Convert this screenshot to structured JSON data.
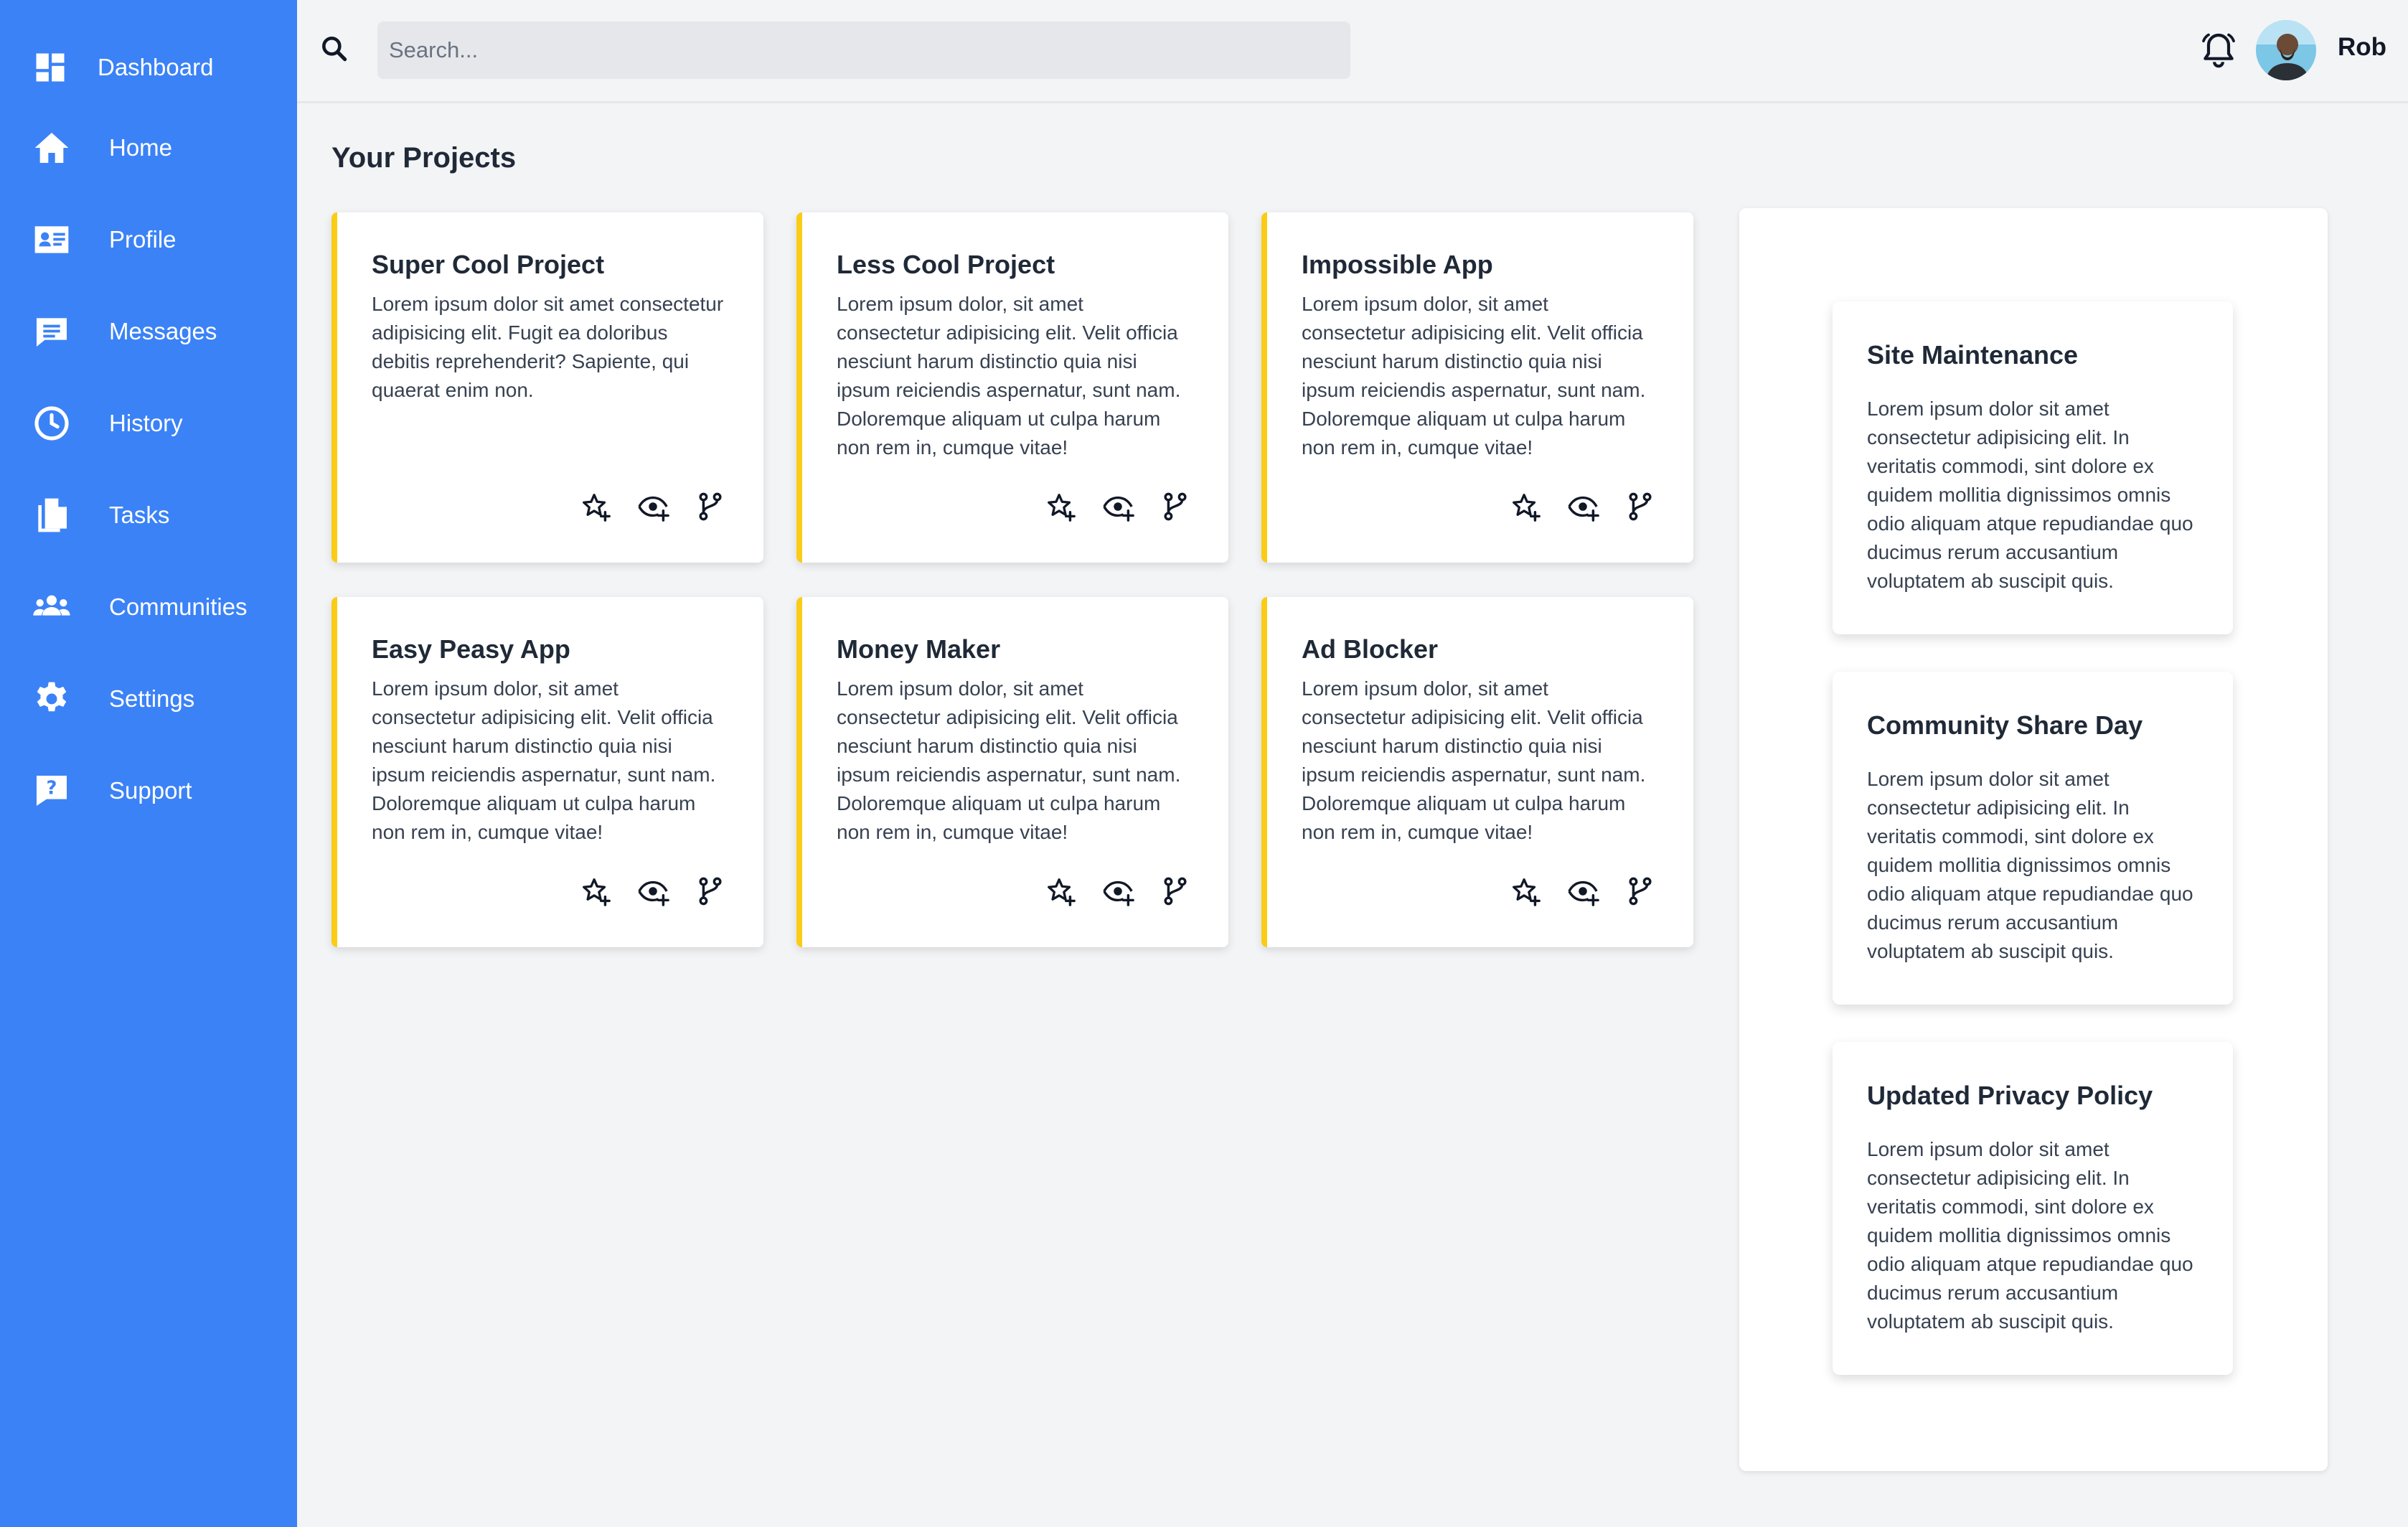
{
  "sidebar": {
    "brand": "Dashboard",
    "items": [
      {
        "label": "Home",
        "icon": "home-icon"
      },
      {
        "label": "Profile",
        "icon": "id-card-icon"
      },
      {
        "label": "Messages",
        "icon": "message-icon"
      },
      {
        "label": "History",
        "icon": "clock-icon"
      },
      {
        "label": "Tasks",
        "icon": "documents-icon"
      },
      {
        "label": "Communities",
        "icon": "users-icon"
      },
      {
        "label": "Settings",
        "icon": "gear-icon"
      },
      {
        "label": "Support",
        "icon": "help-chat-icon"
      }
    ]
  },
  "header": {
    "search_placeholder": "Search...",
    "user_name": "Rob"
  },
  "main": {
    "section_title": "Your Projects",
    "projects": [
      {
        "title": "Super Cool Project",
        "description": "Lorem ipsum dolor sit amet consectetur adipisicing elit. Fugit ea doloribus debitis reprehenderit? Sapiente, qui quaerat enim non."
      },
      {
        "title": "Less Cool Project",
        "description": "Lorem ipsum dolor, sit amet consectetur adipisicing elit. Velit officia nesciunt harum distinctio quia nisi ipsum reiciendis aspernatur, sunt nam. Doloremque aliquam ut culpa harum non rem in, cumque vitae!"
      },
      {
        "title": "Impossible App",
        "description": "Lorem ipsum dolor, sit amet consectetur adipisicing elit. Velit officia nesciunt harum distinctio quia nisi ipsum reiciendis aspernatur, sunt nam. Doloremque aliquam ut culpa harum non rem in, cumque vitae!"
      },
      {
        "title": "Easy Peasy App",
        "description": "Lorem ipsum dolor, sit amet consectetur adipisicing elit. Velit officia nesciunt harum distinctio quia nisi ipsum reiciendis aspernatur, sunt nam. Doloremque aliquam ut culpa harum non rem in, cumque vitae!"
      },
      {
        "title": "Money Maker",
        "description": "Lorem ipsum dolor, sit amet consectetur adipisicing elit. Velit officia nesciunt harum distinctio quia nisi ipsum reiciendis aspernatur, sunt nam. Doloremque aliquam ut culpa harum non rem in, cumque vitae!"
      },
      {
        "title": "Ad Blocker",
        "description": "Lorem ipsum dolor, sit amet consectetur adipisicing elit. Velit officia nesciunt harum distinctio quia nisi ipsum reiciendis aspernatur, sunt nam. Doloremque aliquam ut culpa harum non rem in, cumque vitae!"
      }
    ],
    "project_actions": [
      "star-add-icon",
      "watch-icon",
      "fork-icon"
    ]
  },
  "announcements": [
    {
      "title": "Site Maintenance",
      "description": "Lorem ipsum dolor sit amet consectetur adipisicing elit. In veritatis commodi, sint dolore ex quidem mollitia dignissimos omnis odio aliquam atque repudiandae quo ducimus rerum accusantium voluptatem ab suscipit quis."
    },
    {
      "title": "Community Share Day",
      "description": "Lorem ipsum dolor sit amet consectetur adipisicing elit. In veritatis commodi, sint dolore ex quidem mollitia dignissimos omnis odio aliquam atque repudiandae quo ducimus rerum accusantium voluptatem ab suscipit quis."
    },
    {
      "title": "Updated Privacy Policy",
      "description": "Lorem ipsum dolor sit amet consectetur adipisicing elit. In veritatis commodi, sint dolore ex quidem mollitia dignissimos omnis odio aliquam atque repudiandae quo ducimus rerum accusantium voluptatem ab suscipit quis."
    }
  ],
  "colors": {
    "sidebar": "#3b82f6",
    "card_accent": "#facc15",
    "background": "#f3f4f6"
  }
}
